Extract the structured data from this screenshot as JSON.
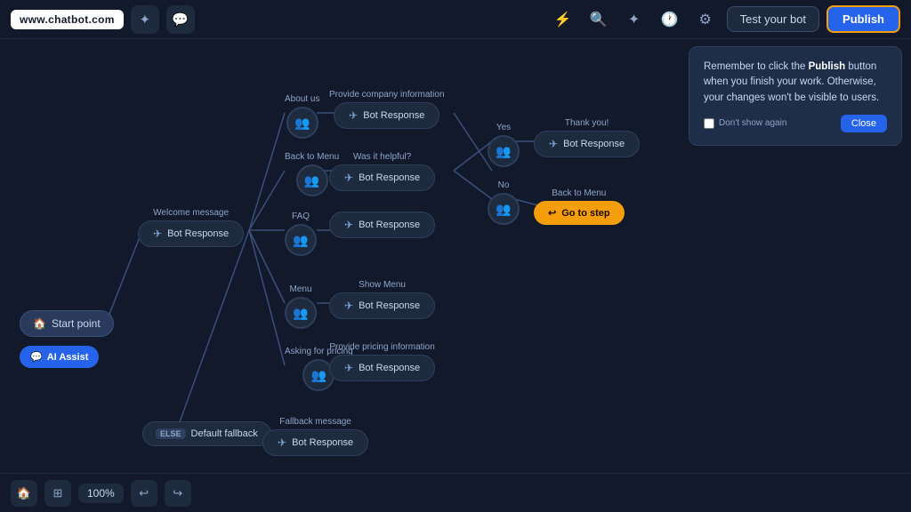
{
  "topbar": {
    "brand": "www.chatbot.com",
    "test_button": "Test your bot",
    "publish_button": "Publish"
  },
  "tooltip": {
    "message": "Remember to click the Publish button when you finish your work. Otherwise, your changes won't be visible to users.",
    "publish_bold": "Publish",
    "dont_show": "Don't show again",
    "close": "Close"
  },
  "nodes": {
    "start_point": "Start point",
    "ai_assist": "AI Assist",
    "welcome_message_label": "Welcome message",
    "bot_response": "Bot Response",
    "about_us_label": "About us",
    "provide_company_label": "Provide company information",
    "back_to_menu_label": "Back to Menu",
    "was_helpful_label": "Was it helpful?",
    "yes_label": "Yes",
    "thank_you_label": "Thank you!",
    "no_label": "No",
    "back_to_menu_goto_label": "Back to Menu",
    "go_to_step": "Go to step",
    "faq_label": "FAQ",
    "menu_label": "Menu",
    "show_menu_label": "Show Menu",
    "asking_pricing_label": "Asking for pricing",
    "provide_pricing_label": "Provide pricing information",
    "fallback_message_label": "Fallback message",
    "default_fallback": "Default fallback",
    "else_badge": "ELSE"
  },
  "bottombar": {
    "zoom": "100%",
    "undo_label": "Undo",
    "redo_label": "Redo"
  }
}
